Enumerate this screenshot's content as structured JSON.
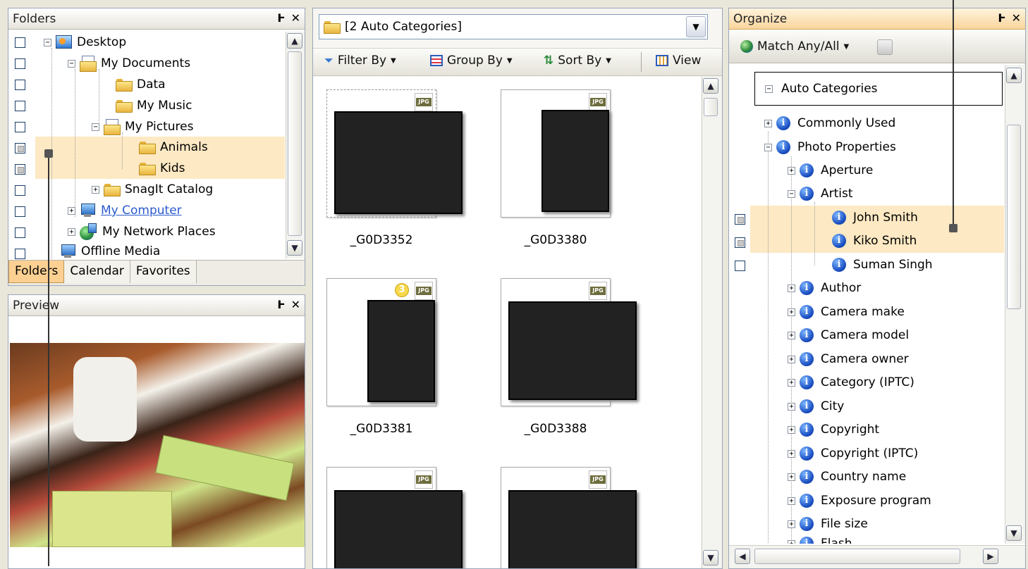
{
  "folders_pane": {
    "title": "Folders",
    "pin": "Ͱ",
    "close": "✕",
    "tree": [
      {
        "label": "Desktop",
        "state": "minus"
      },
      {
        "label": "My Documents",
        "state": "minus"
      },
      {
        "label": "Data",
        "state": "none"
      },
      {
        "label": "My Music",
        "state": "none"
      },
      {
        "label": "My Pictures",
        "state": "minus"
      },
      {
        "label": "Animals",
        "state": "none"
      },
      {
        "label": "Kids",
        "state": "none"
      },
      {
        "label": "SnagIt Catalog",
        "state": "plus"
      },
      {
        "label": "My Computer",
        "state": "plus"
      },
      {
        "label": "My Network Places",
        "state": "plus"
      },
      {
        "label": "Offline Media",
        "state": "none"
      }
    ],
    "tabs": [
      "Folders",
      "Calendar",
      "Favorites"
    ]
  },
  "preview_pane": {
    "title": "Preview"
  },
  "browser": {
    "location": "[2 Auto Categories]",
    "toolbar": {
      "filter": "Filter By",
      "group": "Group By",
      "sort": "Sort By",
      "view": "View"
    },
    "badge_label": "JPG",
    "rating_badge": "3",
    "thumbnails": [
      "_G0D3352",
      "_G0D3380",
      "_G0D3381",
      "_G0D3388"
    ]
  },
  "organize_pane": {
    "title": "Organize",
    "match": "Match Any/All",
    "root": "Auto Categories",
    "items": [
      "Commonly Used",
      "Photo Properties",
      "Aperture",
      "Artist",
      "John Smith",
      "Kiko Smith",
      "Suman Singh",
      "Author",
      "Camera make",
      "Camera model",
      "Camera owner",
      "Category (IPTC)",
      "City",
      "Copyright",
      "Copyright (IPTC)",
      "Country name",
      "Exposure program",
      "File size",
      "Flash"
    ]
  },
  "colors": {
    "highlight": "#fde9c3",
    "tab_active": "#fcd092",
    "header_orange": "#f9d59c"
  }
}
